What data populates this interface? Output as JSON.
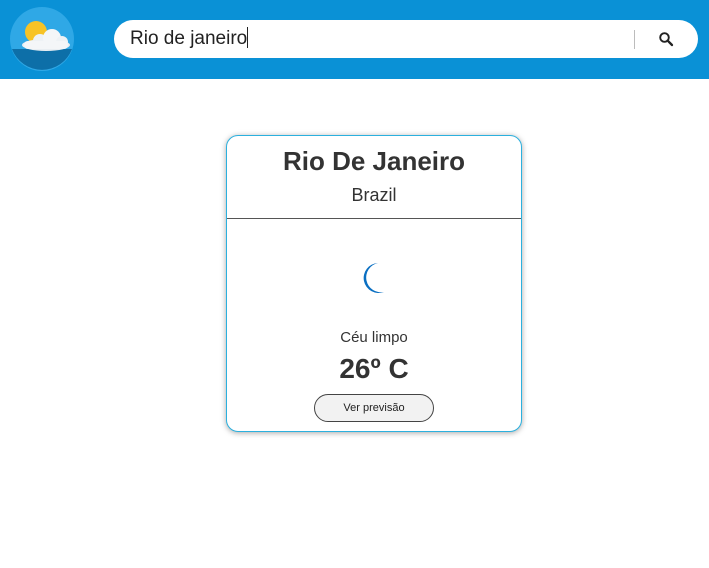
{
  "header": {
    "logo_icon": "sun-cloud-icon",
    "background_color": "#0a91d6"
  },
  "search": {
    "value": "Rio de janeiro",
    "button_icon": "search-icon"
  },
  "weather_card": {
    "city": "Rio De Janeiro",
    "country": "Brazil",
    "icon": "crescent-moon-icon",
    "icon_color": "#0a6fc2",
    "condition": "Céu limpo",
    "temperature": "26º C",
    "forecast_button_label": "Ver previsão"
  }
}
